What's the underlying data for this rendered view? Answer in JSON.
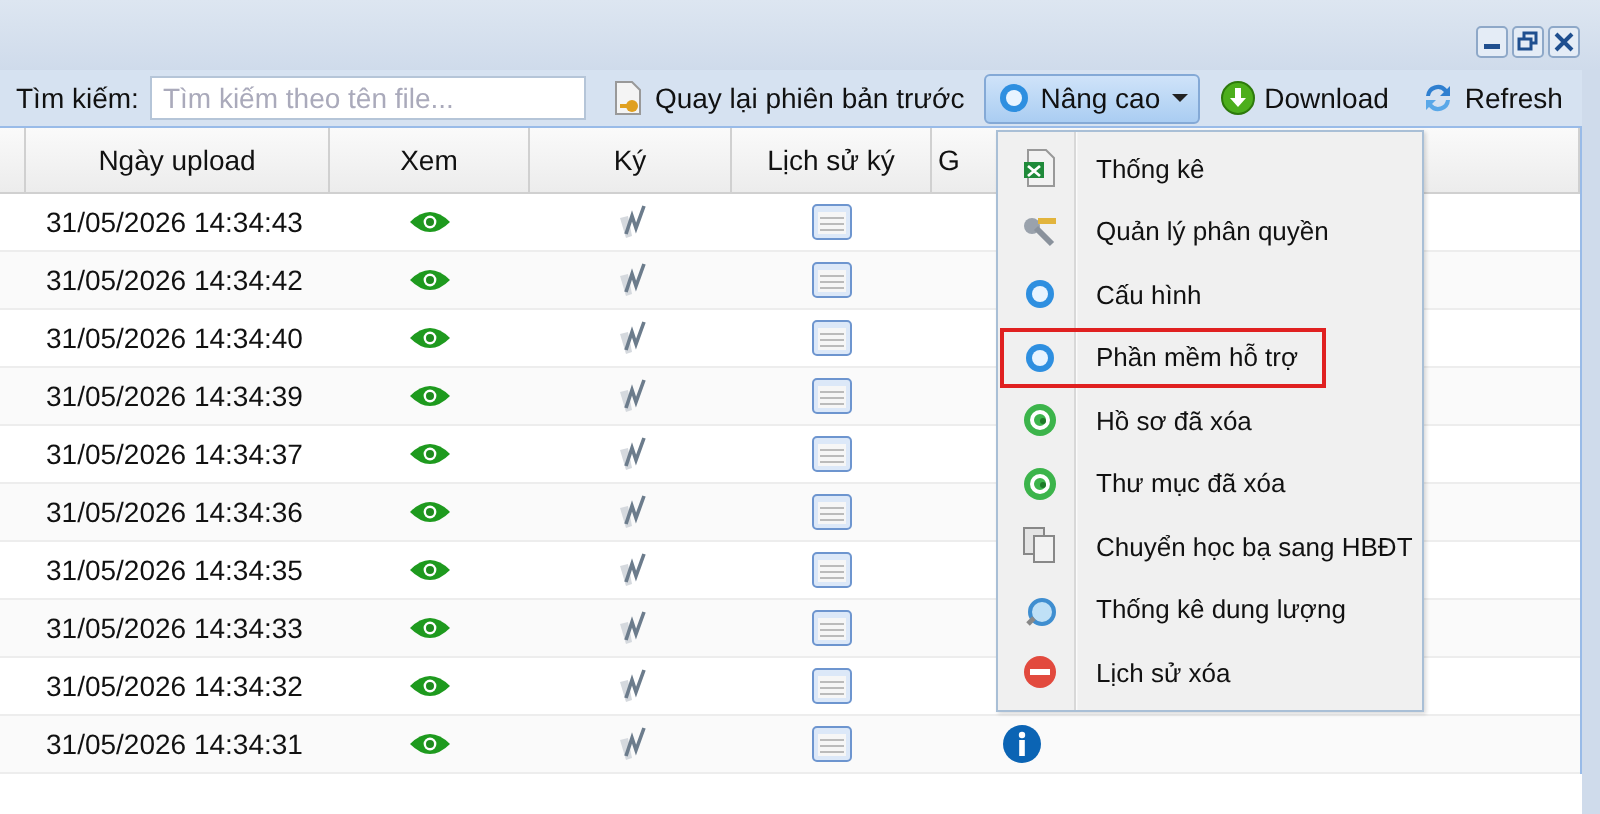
{
  "toolbar": {
    "search_label": "Tìm kiếm:",
    "search": {
      "placeholder": "Tìm kiếm theo tên file..."
    },
    "buttons": [
      {
        "kind": "restore",
        "label": "Quay lại phiên bản trước",
        "expanded": false
      },
      {
        "kind": "advanced",
        "label": "Nâng cao",
        "expanded": true
      },
      {
        "kind": "download",
        "label": "Download",
        "expanded": false
      },
      {
        "kind": "refresh",
        "label": "Refresh",
        "expanded": false
      }
    ]
  },
  "table": {
    "columns": [
      "",
      "Ngày upload",
      "Xem",
      "Ký",
      "Lịch sử ký",
      "G"
    ],
    "rows": [
      {
        "date": "31/05/2026 14:34:43"
      },
      {
        "date": "31/05/2026 14:34:42"
      },
      {
        "date": "31/05/2026 14:34:40"
      },
      {
        "date": "31/05/2026 14:34:39"
      },
      {
        "date": "31/05/2026 14:34:37"
      },
      {
        "date": "31/05/2026 14:34:36"
      },
      {
        "date": "31/05/2026 14:34:35"
      },
      {
        "date": "31/05/2026 14:34:33"
      },
      {
        "date": "31/05/2026 14:34:32"
      },
      {
        "date": "31/05/2026 14:34:31"
      }
    ]
  },
  "menu": {
    "items": [
      {
        "kind": "excel",
        "label": "Thống kê",
        "highlighted": false
      },
      {
        "kind": "keys",
        "label": "Quản lý phân quyền",
        "highlighted": false
      },
      {
        "kind": "ring",
        "label": "Cấu hình",
        "highlighted": false
      },
      {
        "kind": "ring",
        "label": "Phần mềm hỗ trợ",
        "highlighted": true
      },
      {
        "kind": "recycle",
        "label": "Hồ sơ đã xóa",
        "highlighted": false
      },
      {
        "kind": "recycle",
        "label": "Thư mục đã xóa",
        "highlighted": false
      },
      {
        "kind": "copy",
        "label": "Chuyển học bạ sang HBĐT",
        "highlighted": false
      },
      {
        "kind": "zoom",
        "label": "Thống kê dung lượng",
        "highlighted": false
      },
      {
        "kind": "delete",
        "label": "Lịch sử xóa",
        "highlighted": false
      }
    ]
  }
}
